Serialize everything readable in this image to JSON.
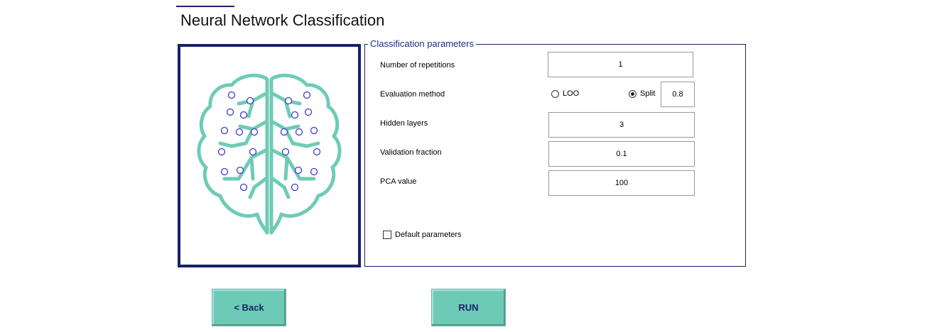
{
  "header": {
    "title": "Neural Network Classification"
  },
  "params": {
    "legend": "Classification parameters",
    "repetitions": {
      "label": "Number of repetitions",
      "value": "1"
    },
    "evaluation": {
      "label": "Evaluation method",
      "loo_label": "LOO",
      "split_label": "Split",
      "selected": "Split",
      "split_value": "0.8"
    },
    "hidden_layers": {
      "label": "Hidden layers",
      "value": "3"
    },
    "validation_fraction": {
      "label": "Validation fraction",
      "value": "0.1"
    },
    "pca": {
      "label": "PCA value",
      "value": "100"
    },
    "default_params": {
      "label": "Default parameters",
      "checked": false
    }
  },
  "buttons": {
    "back": "<  Back",
    "run": "RUN"
  },
  "colors": {
    "accent": "#6ccab6",
    "brain": "#6fcbb6",
    "node": "#3c3cc8",
    "frame": "#16206a"
  },
  "icons": {
    "panel_image": "brain-network-icon"
  }
}
